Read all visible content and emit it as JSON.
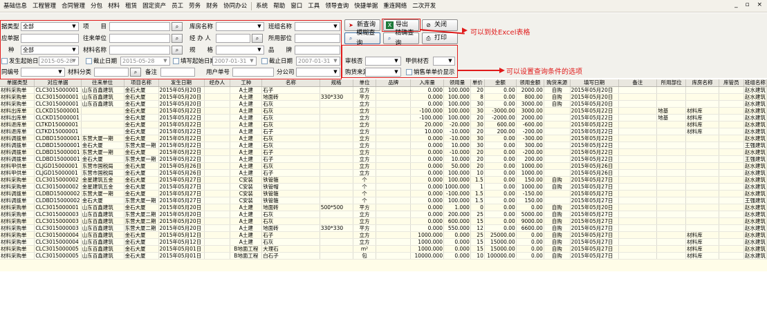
{
  "menu": [
    "基础信息",
    "工程管理",
    "合同管理",
    "分包",
    "材料",
    "租赁",
    "固定资产",
    "员工",
    "劳务",
    "财务",
    "协同办公",
    "系统",
    "帮助",
    "窗口",
    "工具",
    "领导查询",
    "快捷单据",
    "重连网络",
    "二次开发"
  ],
  "window_controls": "_ ▫ ×",
  "filters": {
    "doc_type_label": "据类型",
    "doc_type_value": "全部",
    "item_label": "项　　目",
    "item_value": "",
    "warehouse_label": "库房名称",
    "warehouse_value": "",
    "team_label": "班组名称",
    "team_value": "",
    "corr_doc_label": "应单据",
    "corr_doc_value": "",
    "partner_label": "往来单位",
    "partner_value": "",
    "handler_label": "经 办 人",
    "handler_value": "",
    "dept_label": "所用部位",
    "dept_value": "",
    "kind_label": "种",
    "kind_value": "全部",
    "material_label": "材料名称",
    "material_value": "",
    "spec_label": "规　　格",
    "spec_value": "",
    "quality_label": "品　　牌",
    "quality_value": "",
    "start_date_label": "发生起始日期",
    "start_date_value": "2015-05-28",
    "end_date_label": "截止日期",
    "end_date_value": "2015-05-28",
    "fill_start_label": "填写起始日期",
    "fill_start_value": "2007-01-31",
    "fill_end_label": "截止日期",
    "fill_end_value": "2007-01-31",
    "contract_no_label": "同编号",
    "contract_no_value": "",
    "mat_class_label": "材料分类",
    "mat_class_value": "",
    "remark_label": "备注",
    "remark_value": "",
    "user_no_label": "用户单号",
    "user_no_value": "",
    "company_label": "分公司",
    "company_value": "",
    "audit_label": "审核否",
    "audit_value": "",
    "supply_label": "甲供材否",
    "supply_value": "",
    "purchase_label": "购货来源",
    "purchase_value": "",
    "price_show_label": "销售单单价显示"
  },
  "buttons": {
    "new_query": "新查询",
    "export": "导出",
    "close": "关闭",
    "fuzzy_query": "模糊查询",
    "exact_query": "精确查询",
    "print": "打印"
  },
  "annotations": {
    "export_note": "可以到处Excel表格",
    "query_note": "可以设置查询条件的选项"
  },
  "colors": {
    "annotation": "#e01a1a",
    "grid_bg": "#fffde8"
  },
  "table": {
    "headers": [
      "单据类型",
      "对应单据",
      "往来单位",
      "项目名称",
      "发生日期",
      "经办人",
      "工种",
      "名称",
      "规格",
      "单位",
      "品牌",
      "入库量",
      "领用量",
      "单价",
      "金额",
      "领用金额",
      "购货来源",
      "填写日期",
      "备注",
      "所用部位",
      "库房名称",
      "库管员",
      "班组名称"
    ],
    "rows": [
      [
        "材料采购单",
        "CLC3015000001",
        "山东百鑫建筑",
        "金石大厦",
        "2015年05月20日",
        "",
        "A土建",
        "石子",
        "",
        "立方",
        "",
        "0.000",
        "100.000",
        "20",
        "0.00",
        "2000.00",
        "自购",
        "2015年05月20日",
        "",
        "",
        "",
        "",
        "赵水建筑"
      ],
      [
        "材料采购单",
        "CLC3015000001",
        "山东百鑫建筑",
        "金石大厦",
        "2015年05月20日",
        "",
        "A土建",
        "地面砖",
        "330*330",
        "平方",
        "",
        "0.000",
        "100.000",
        "8",
        "0.00",
        "800.00",
        "自购",
        "2015年05月20日",
        "",
        "",
        "",
        "",
        "赵水建筑"
      ],
      [
        "材料采购单",
        "CLC3015000001",
        "山东百鑫建筑",
        "金石大厦",
        "2015年05月20日",
        "",
        "A土建",
        "石灰",
        "",
        "立方",
        "",
        "0.000",
        "100.000",
        "30",
        "0.00",
        "3000.00",
        "自购",
        "2015年05月20日",
        "",
        "",
        "",
        "",
        "赵水建筑"
      ],
      [
        "材料出库单",
        "CLCKD15000001",
        "",
        "金石大厦",
        "2015年05月22日",
        "",
        "A土建",
        "石灰",
        "",
        "立方",
        "",
        "-100.000",
        "100.000",
        "30",
        "-3000.00",
        "3000.00",
        "",
        "2015年05月22日",
        "",
        "地基",
        "材料库",
        "",
        "赵水建筑"
      ],
      [
        "材料出库单",
        "CLCKD15000001",
        "",
        "金石大厦",
        "2015年05月22日",
        "",
        "A土建",
        "石灰",
        "",
        "立方",
        "",
        "-100.000",
        "100.000",
        "20",
        "-2000.00",
        "2000.00",
        "",
        "2015年05月22日",
        "",
        "地基",
        "材料库",
        "",
        "赵水建筑"
      ],
      [
        "材料退库单",
        "CLTKD15000001",
        "",
        "金石大厦",
        "2015年05月22日",
        "",
        "A土建",
        "石灰",
        "",
        "立方",
        "",
        "20.000",
        "-20.000",
        "30",
        "600.00",
        "-600.00",
        "",
        "2015年05月22日",
        "",
        "",
        "材料库",
        "",
        "赵水建筑"
      ],
      [
        "材料退库单",
        "CLTKD15000001",
        "",
        "金石大厦",
        "2015年05月22日",
        "",
        "A土建",
        "石子",
        "",
        "立方",
        "",
        "10.000",
        "-10.000",
        "20",
        "200.00",
        "-200.00",
        "",
        "2015年05月22日",
        "",
        "",
        "材料库",
        "",
        "赵水建筑"
      ],
      [
        "材料调拨单",
        "CLDBD15000001",
        "东营大厦一期",
        "金石大厦",
        "2015年05月22日",
        "",
        "A土建",
        "石灰",
        "",
        "立方",
        "",
        "0.000",
        "-10.000",
        "30",
        "0.00",
        "-300.00",
        "",
        "2015年05月22日",
        "",
        "",
        "",
        "",
        "赵水建筑"
      ],
      [
        "材料调拨单",
        "CLDBD15000001",
        "金石大厦",
        "东营大厦一期",
        "2015年05月22日",
        "",
        "A土建",
        "石灰",
        "",
        "立方",
        "",
        "0.000",
        "10.000",
        "30",
        "0.00",
        "300.00",
        "",
        "2015年05月22日",
        "",
        "",
        "",
        "",
        "王强建筑"
      ],
      [
        "材料调拨单",
        "CLDBD15000001",
        "东营大厦一期",
        "金石大厦",
        "2015年05月22日",
        "",
        "A土建",
        "石子",
        "",
        "立方",
        "",
        "0.000",
        "-10.000",
        "20",
        "0.00",
        "-200.00",
        "",
        "2015年05月22日",
        "",
        "",
        "",
        "",
        "赵水建筑"
      ],
      [
        "材料调拨单",
        "CLDBD15000001",
        "金石大厦",
        "东营大厦一期",
        "2015年05月22日",
        "",
        "A土建",
        "石子",
        "",
        "立方",
        "",
        "0.000",
        "10.000",
        "20",
        "0.00",
        "200.00",
        "",
        "2015年05月22日",
        "",
        "",
        "",
        "",
        "王强建筑"
      ],
      [
        "材料甲供单",
        "CLJGD15000001",
        "东营市国税局",
        "金石大厦",
        "2015年05月26日",
        "",
        "A土建",
        "石灰",
        "",
        "立方",
        "",
        "0.000",
        "50.000",
        "20",
        "0.00",
        "1000.00",
        "",
        "2015年05月26日",
        "",
        "",
        "",
        "",
        "赵水建筑"
      ],
      [
        "材料甲供单",
        "CLJGD15000001",
        "东营市国税局",
        "金石大厦",
        "2015年05月26日",
        "",
        "A土建",
        "石子",
        "",
        "立方",
        "",
        "0.000",
        "100.000",
        "10",
        "0.00",
        "1000.00",
        "",
        "2015年05月26日",
        "",
        "",
        "",
        "",
        "赵水建筑"
      ],
      [
        "材料采购单",
        "CLC3015000002",
        "金星建筑五金",
        "金石大厦",
        "2015年05月27日",
        "",
        "C安装",
        "铁管箍",
        "",
        "个",
        "",
        "0.000",
        "100.000",
        "1.5",
        "0.00",
        "150.00",
        "自购",
        "2015年05月27日",
        "",
        "",
        "",
        "",
        "赵水建筑"
      ],
      [
        "材料采购单",
        "CLC3015000002",
        "金星建筑五金",
        "金石大厦",
        "2015年05月27日",
        "",
        "C安装",
        "铁管帽",
        "",
        "个",
        "",
        "0.000",
        "1000.000",
        "1",
        "0.00",
        "1000.00",
        "自购",
        "2015年05月27日",
        "",
        "",
        "",
        "",
        "赵水建筑"
      ],
      [
        "材料调拨单",
        "CLDBD15000002",
        "东营大厦一期",
        "金石大厦",
        "2015年05月27日",
        "",
        "C安装",
        "铁管箍",
        "",
        "个",
        "",
        "0.000",
        "-100.000",
        "1.5",
        "0.00",
        "-150.00",
        "",
        "2015年05月27日",
        "",
        "",
        "",
        "",
        "赵水建筑"
      ],
      [
        "材料调拨单",
        "CLDBD15000002",
        "金石大厦",
        "东营大厦一期",
        "2015年05月27日",
        "",
        "C安装",
        "铁管箍",
        "",
        "个",
        "",
        "0.000",
        "100.000",
        "1.5",
        "0.00",
        "150.00",
        "",
        "2015年05月27日",
        "",
        "",
        "",
        "",
        "王强建筑"
      ],
      [
        "材料采购单",
        "CLC3015000001",
        "山东百鑫建筑",
        "金石大厦",
        "2015年05月20日",
        "",
        "A土建",
        "地面砖",
        "500*500",
        "平方",
        "",
        "0.000",
        "1.000",
        "0",
        "0.00",
        "0.00",
        "自购",
        "2015年05月20日",
        "",
        "",
        "",
        "",
        "赵水建筑"
      ],
      [
        "材料采购单",
        "CLC3015000003",
        "山东百鑫建筑",
        "东营大厦二期",
        "2015年05月20日",
        "",
        "A土建",
        "石灰",
        "",
        "立方",
        "",
        "0.000",
        "200.000",
        "25",
        "0.00",
        "5000.00",
        "自购",
        "2015年05月27日",
        "",
        "",
        "",
        "",
        "赵水建筑"
      ],
      [
        "材料采购单",
        "CLC3015000003",
        "山东百鑫建筑",
        "东营大厦二期",
        "2015年05月20日",
        "",
        "A土建",
        "石灰",
        "",
        "立方",
        "",
        "0.000",
        "600.000",
        "15",
        "0.00",
        "9000.00",
        "自购",
        "2015年05月27日",
        "",
        "",
        "",
        "",
        "赵水建筑"
      ],
      [
        "材料采购单",
        "CLC3015000003",
        "山东百鑫建筑",
        "东营大厦二期",
        "2015年05月20日",
        "",
        "A土建",
        "地面砖",
        "330*330",
        "平方",
        "",
        "0.000",
        "550.000",
        "12",
        "0.00",
        "6600.00",
        "自购",
        "2015年05月27日",
        "",
        "",
        "",
        "",
        "赵水建筑"
      ],
      [
        "材料采购单",
        "CLC3015000004",
        "山东百鑫建筑",
        "金石大厦",
        "2015年05月12日",
        "",
        "A土建",
        "石子",
        "",
        "立方",
        "",
        "1000.000",
        "0.000",
        "25",
        "25000.00",
        "0.00",
        "自购",
        "2015年05月27日",
        "",
        "",
        "材料库",
        "",
        "赵水建筑"
      ],
      [
        "材料采购单",
        "CLC3015000004",
        "山东百鑫建筑",
        "金石大厦",
        "2015年05月12日",
        "",
        "A土建",
        "石灰",
        "",
        "立方",
        "",
        "1000.000",
        "0.000",
        "15",
        "15000.00",
        "0.00",
        "自购",
        "2015年05月27日",
        "",
        "",
        "材料库",
        "",
        "赵水建筑"
      ],
      [
        "材料采购单",
        "CLC3015000005",
        "山东百鑫建筑",
        "金石大厦",
        "2015年05月01日",
        "",
        "B地面工程",
        "大理石",
        "",
        "m²",
        "",
        "1000.000",
        "0.000",
        "15",
        "15000.00",
        "0.00",
        "自购",
        "2015年05月27日",
        "",
        "",
        "材料库",
        "",
        "赵水建筑"
      ],
      [
        "材料采购单",
        "CLC3015000005",
        "山东百鑫建筑",
        "金石大厦",
        "2015年05月01日",
        "",
        "B地面工程",
        "白石子",
        "",
        "包",
        "",
        "10000.000",
        "0.000",
        "10",
        "100000.00",
        "0.00",
        "自购",
        "2015年05月27日",
        "",
        "",
        "材料库",
        "",
        "赵水建筑"
      ]
    ]
  }
}
